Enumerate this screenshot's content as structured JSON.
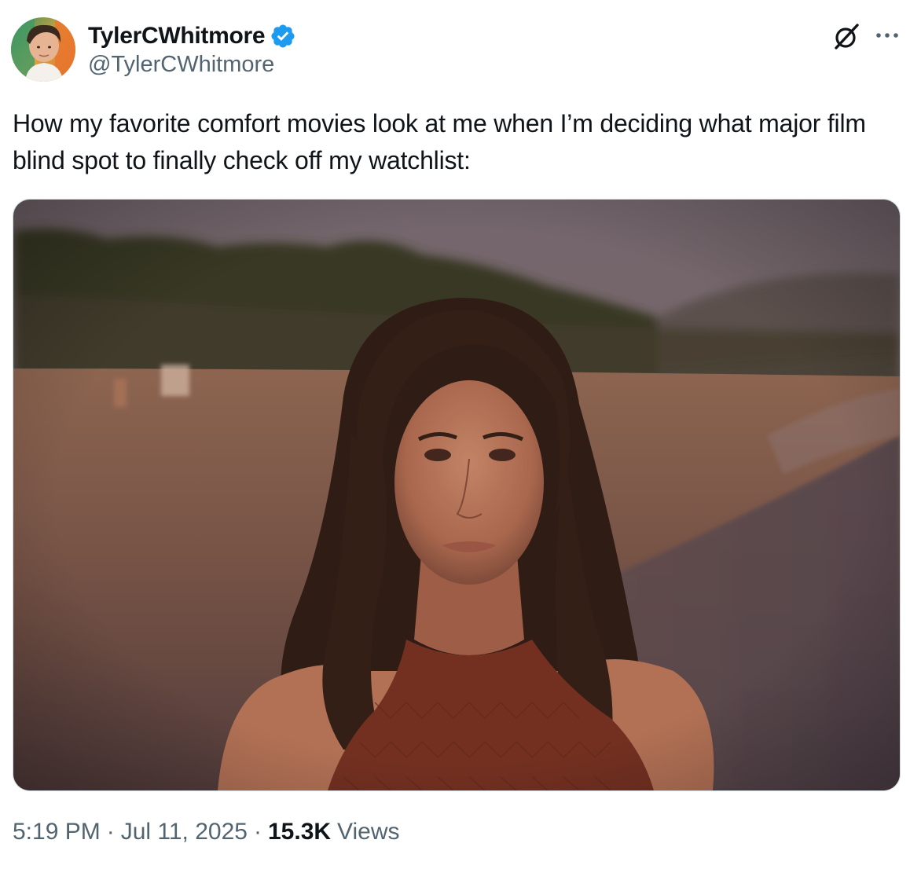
{
  "author": {
    "display_name": "TylerCWhitmore",
    "handle": "@TylerCWhitmore",
    "verified": true,
    "avatar_icon": "profile-photo-avatar"
  },
  "tweet": {
    "text": "How my favorite comfort movies look at me when I’m deciding what major film blind spot to finally check off my watchlist:",
    "media_description": "photo-of-woman-on-beach-at-dusk"
  },
  "meta": {
    "time": "5:19 PM",
    "separator": "·",
    "date": "Jul 11, 2025",
    "views_count": "15.3K",
    "views_label": "Views"
  },
  "icons": {
    "verified": "verified-badge-icon",
    "grok": "grok-icon",
    "more": "more-options-icon"
  },
  "colors": {
    "text_primary": "#0f1419",
    "text_secondary": "#536471",
    "verified_blue": "#1d9bf0",
    "border": "#cfd9de"
  }
}
